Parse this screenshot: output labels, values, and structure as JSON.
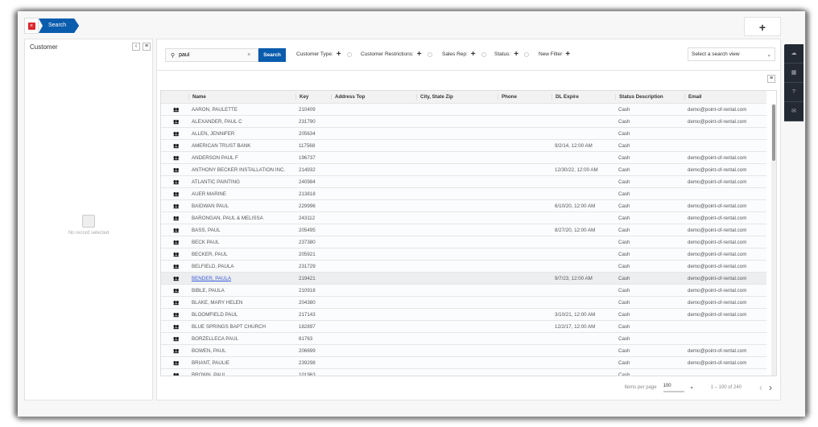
{
  "tabs": [
    {
      "label": "Search",
      "close_icon": "close-icon"
    }
  ],
  "add_button": "+",
  "left_panel": {
    "title": "Customer",
    "empty_text": "No record selected"
  },
  "search": {
    "value": "paul",
    "button": "Search"
  },
  "filters": [
    {
      "label": "Customer Type:"
    },
    {
      "label": "Customer Restrictions:"
    },
    {
      "label": "Sales Rep:"
    },
    {
      "label": "Status:"
    },
    {
      "label": "New Filter"
    }
  ],
  "search_view": {
    "placeholder": "Select a search view"
  },
  "table": {
    "columns": [
      "",
      "Name",
      "Key",
      "Address Top",
      "City, State Zip",
      "Phone",
      "DL Expire",
      "Status Description",
      "Email"
    ],
    "rows": [
      [
        "AARON, PAULETTE",
        "210409",
        "",
        "",
        "",
        "",
        "Cash",
        "demo@point-of-rental.com"
      ],
      [
        "ALEXANDER, PAUL C",
        "231790",
        "",
        "",
        "",
        "",
        "Cash",
        "demo@point-of-rental.com"
      ],
      [
        "ALLEN, JENNIFER",
        "205634",
        "",
        "",
        "",
        "",
        "Cash",
        ""
      ],
      [
        "AMERICAN TRUST BANK",
        "117568",
        "",
        "",
        "",
        "9/2/14, 12:00 AM",
        "Cash",
        ""
      ],
      [
        "ANDERSON PAUL F",
        "196737",
        "",
        "",
        "",
        "",
        "Cash",
        "demo@point-of-rental.com"
      ],
      [
        "ANTHONY BECKER INSTALLATION INC.",
        "214932",
        "",
        "",
        "",
        "12/30/22, 12:00 AM",
        "Cash",
        "demo@point-of-rental.com"
      ],
      [
        "ATLANTIC PAINTING",
        "240984",
        "",
        "",
        "",
        "",
        "Cash",
        "demo@point-of-rental.com"
      ],
      [
        "AUER MARINE",
        "213818",
        "",
        "",
        "",
        "",
        "Cash",
        ""
      ],
      [
        "BAIDWAN PAUL",
        "229996",
        "",
        "",
        "",
        "6/10/20, 12:00 AM",
        "Cash",
        "demo@point-of-rental.com"
      ],
      [
        "BARONGAN, PAUL & MELISSA",
        "243112",
        "",
        "",
        "",
        "",
        "Cash",
        "demo@point-of-rental.com"
      ],
      [
        "BASS, PAUL",
        "205495",
        "",
        "",
        "",
        "8/27/20, 12:00 AM",
        "Cash",
        "demo@point-of-rental.com"
      ],
      [
        "BECK PAUL",
        "237380",
        "",
        "",
        "",
        "",
        "Cash",
        "demo@point-of-rental.com"
      ],
      [
        "BECKER, PAUL",
        "205921",
        "",
        "",
        "",
        "",
        "Cash",
        "demo@point-of-rental.com"
      ],
      [
        "BELFIELD, PAULA",
        "231729",
        "",
        "",
        "",
        "",
        "Cash",
        "demo@point-of-rental.com"
      ],
      [
        "BENDER, PAULA",
        "219421",
        "",
        "",
        "",
        "9/7/23, 12:00 AM",
        "Cash",
        "demo@point-of-rental.com"
      ],
      [
        "BIBLE, PAULA",
        "210918",
        "",
        "",
        "",
        "",
        "Cash",
        "demo@point-of-rental.com"
      ],
      [
        "BLAKE, MARY HELEN",
        "204380",
        "",
        "",
        "",
        "",
        "Cash",
        "demo@point-of-rental.com"
      ],
      [
        "BLOOMFIELD PAUL",
        "217143",
        "",
        "",
        "",
        "3/10/21, 12:00 AM",
        "Cash",
        "demo@point-of-rental.com"
      ],
      [
        "BLUE SPRINGS BAPT CHURCH",
        "182897",
        "",
        "",
        "",
        "12/2/17, 12:00 AM",
        "Cash",
        ""
      ],
      [
        "BORZELLECA PAUL",
        "81763",
        "",
        "",
        "",
        "",
        "Cash",
        ""
      ],
      [
        "BOWEN, PAUL",
        "206699",
        "",
        "",
        "",
        "",
        "Cash",
        "demo@point-of-rental.com"
      ],
      [
        "BRIANT, PAULIE",
        "239298",
        "",
        "",
        "",
        "",
        "Cash",
        "demo@point-of-rental.com"
      ],
      [
        "BROWN, PAUL",
        "101963",
        "",
        "",
        "",
        "",
        "Cash",
        ""
      ]
    ],
    "selected_row": 14,
    "row_icon": "users-icon"
  },
  "pagination": {
    "items_per_page_label": "Items per page",
    "items_per_page": "100",
    "range": "1 – 100 of 240",
    "prev": "‹",
    "next": "›"
  },
  "right_sidebar": [
    {
      "icon": "cloud-icon",
      "glyph": "☁"
    },
    {
      "icon": "calendar-icon",
      "glyph": "▦"
    },
    {
      "icon": "help-icon",
      "glyph": "?"
    },
    {
      "icon": "mail-icon",
      "glyph": "✉"
    }
  ],
  "colors": {
    "accent": "#0a5cad",
    "close": "#d9272e",
    "sidebar": "#232a33",
    "link": "#3a5bd9"
  }
}
